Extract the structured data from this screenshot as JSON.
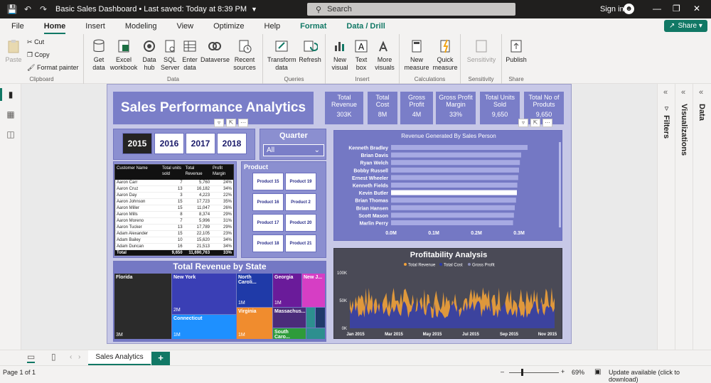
{
  "titlebar": {
    "title": "Basic Sales Dashboard • Last saved: Today at 8:39 PM",
    "search_placeholder": "Search",
    "signin": "Sign in"
  },
  "menu": [
    "File",
    "Home",
    "Insert",
    "Modeling",
    "View",
    "Optimize",
    "Help",
    "Format",
    "Data / Drill"
  ],
  "share_label": "Share",
  "ribbon": {
    "clipboard": {
      "paste": "Paste",
      "cut": "Cut",
      "copy": "Copy",
      "format_painter": "Format painter",
      "label": "Clipboard"
    },
    "data": {
      "get_data": "Get\ndata",
      "excel": "Excel\nworkbook",
      "data_hub": "Data\nhub",
      "sql": "SQL\nServer",
      "enter": "Enter\ndata",
      "dataverse": "Dataverse",
      "recent": "Recent\nsources",
      "label": "Data"
    },
    "queries": {
      "transform": "Transform\ndata",
      "refresh": "Refresh",
      "label": "Queries"
    },
    "insert": {
      "new_visual": "New\nvisual",
      "text_box": "Text\nbox",
      "more_visuals": "More\nvisuals",
      "label": "Insert"
    },
    "calculations": {
      "new_measure": "New\nmeasure",
      "quick_measure": "Quick\nmeasure",
      "label": "Calculations"
    },
    "sensitivity": {
      "sensitivity": "Sensitivity",
      "label": "Sensitivity"
    },
    "share": {
      "publish": "Publish",
      "label": "Share"
    }
  },
  "report": {
    "title": "Sales Performance Analytics",
    "kpis": [
      {
        "label": "Total\nRevenue",
        "value": "303K"
      },
      {
        "label": "Total\nCost",
        "value": "8M"
      },
      {
        "label": "Gross\nProfit",
        "value": "4M"
      },
      {
        "label": "Gross Profit\nMargin",
        "value": "33%"
      },
      {
        "label": "Total Units\nSold",
        "value": "9,650"
      },
      {
        "label": "Total No of\nProduts",
        "value": "9,650"
      }
    ],
    "years": [
      "2015",
      "2016",
      "2017",
      "2018"
    ],
    "quarter_title": "Quarter",
    "quarter_value": "All",
    "product_title": "Product",
    "products": [
      "Product 15",
      "Product 19",
      "Product 16",
      "Product 2",
      "Product 17",
      "Product 20",
      "Product 18",
      "Product 21"
    ],
    "table": {
      "headers": [
        "Customer Name",
        "Total units sold",
        "Total Revenue",
        "Profit Margin"
      ],
      "rows": [
        [
          "Aaron Carr",
          "7",
          "5,760",
          "24%"
        ],
        [
          "Aaron Cruz",
          "13",
          "16,182",
          "34%"
        ],
        [
          "Aaron Day",
          "3",
          "4,223",
          "22%"
        ],
        [
          "Aaron Johnson",
          "15",
          "17,723",
          "35%"
        ],
        [
          "Aaron Miller",
          "15",
          "11,047",
          "26%"
        ],
        [
          "Aaron Mills",
          "8",
          "8,374",
          "29%"
        ],
        [
          "Aaron Moreno",
          "7",
          "5,996",
          "31%"
        ],
        [
          "Aaron Tucker",
          "13",
          "17,789",
          "29%"
        ],
        [
          "Adam Alexander",
          "15",
          "22,105",
          "23%"
        ],
        [
          "Adam Bailey",
          "10",
          "15,620",
          "34%"
        ],
        [
          "Adam Duncan",
          "16",
          "21,513",
          "34%"
        ]
      ],
      "total": [
        "Total",
        "9,650",
        "11,690,763",
        "33%"
      ]
    },
    "treemap_title": "Total Revenue by State",
    "treemap": [
      {
        "name": "Florida",
        "value": "3M"
      },
      {
        "name": "New York",
        "value": "2M"
      },
      {
        "name": "Connecticut",
        "value": "1M"
      },
      {
        "name": "North Caroli...",
        "value": "1M"
      },
      {
        "name": "Georgia",
        "value": "1M"
      },
      {
        "name": "New J...",
        "value": ""
      },
      {
        "name": "Virginia",
        "value": "1M"
      },
      {
        "name": "Massachus...",
        "value": ""
      },
      {
        "name": "South Caro...",
        "value": ""
      }
    ],
    "colors": {
      "florida": "#2b2b2b",
      "newyork": "#3a3fb5",
      "connecticut": "#1e90ff",
      "northcarolina": "#1f3aa8",
      "georgia": "#6a1b9a",
      "newjersey": "#d63ec4",
      "virginia": "#f08c2e",
      "massachusetts": "#4b2c7a",
      "southcarolina": "#2e9b3a",
      "extra1": "#2d8f8f",
      "extra2": "#203a6b",
      "bar": "#a7aae3",
      "bar_highlight": "#ffffff",
      "revenue": "#f0a13a",
      "cost": "#2a3aa8",
      "profit": "#8a8db8"
    }
  },
  "chart_data": [
    {
      "type": "bar",
      "title": "Revenue Generated By Sales Person",
      "categories": [
        "Kenneth Bradley",
        "Brian Davis",
        "Ryan Welch",
        "Bobby Russell",
        "Ernest Wheeler",
        "Kenneth Fields",
        "Kevin Butler",
        "Brian Thomas",
        "Brian Hansen",
        "Scott Mason",
        "Marlin Perry"
      ],
      "values": [
        0.32,
        0.305,
        0.302,
        0.3,
        0.298,
        0.296,
        0.295,
        0.293,
        0.29,
        0.288,
        0.286
      ],
      "xticks": [
        "0.0M",
        "0.1M",
        "0.2M",
        "0.3M"
      ],
      "xlim": [
        0,
        0.35
      ],
      "orientation": "horizontal"
    },
    {
      "type": "area",
      "title": "Profitability Analysis",
      "legend": [
        "Total Revenue",
        "Total Cost",
        "Gross Profit"
      ],
      "yticks": [
        "100K",
        "50K",
        "0K"
      ],
      "xticks": [
        "Jan 2015",
        "Mar 2015",
        "May 2015",
        "Jul 2015",
        "Sep 2015",
        "Nov 2015"
      ],
      "ylim": [
        0,
        100
      ],
      "series_note": "daily values, revenue ~30-75K, cost ~20-50K"
    }
  ],
  "page_tab": "Sales Analytics",
  "status": {
    "page": "Page 1 of 1",
    "zoom": "69%",
    "update": "Update available (click to download)"
  }
}
